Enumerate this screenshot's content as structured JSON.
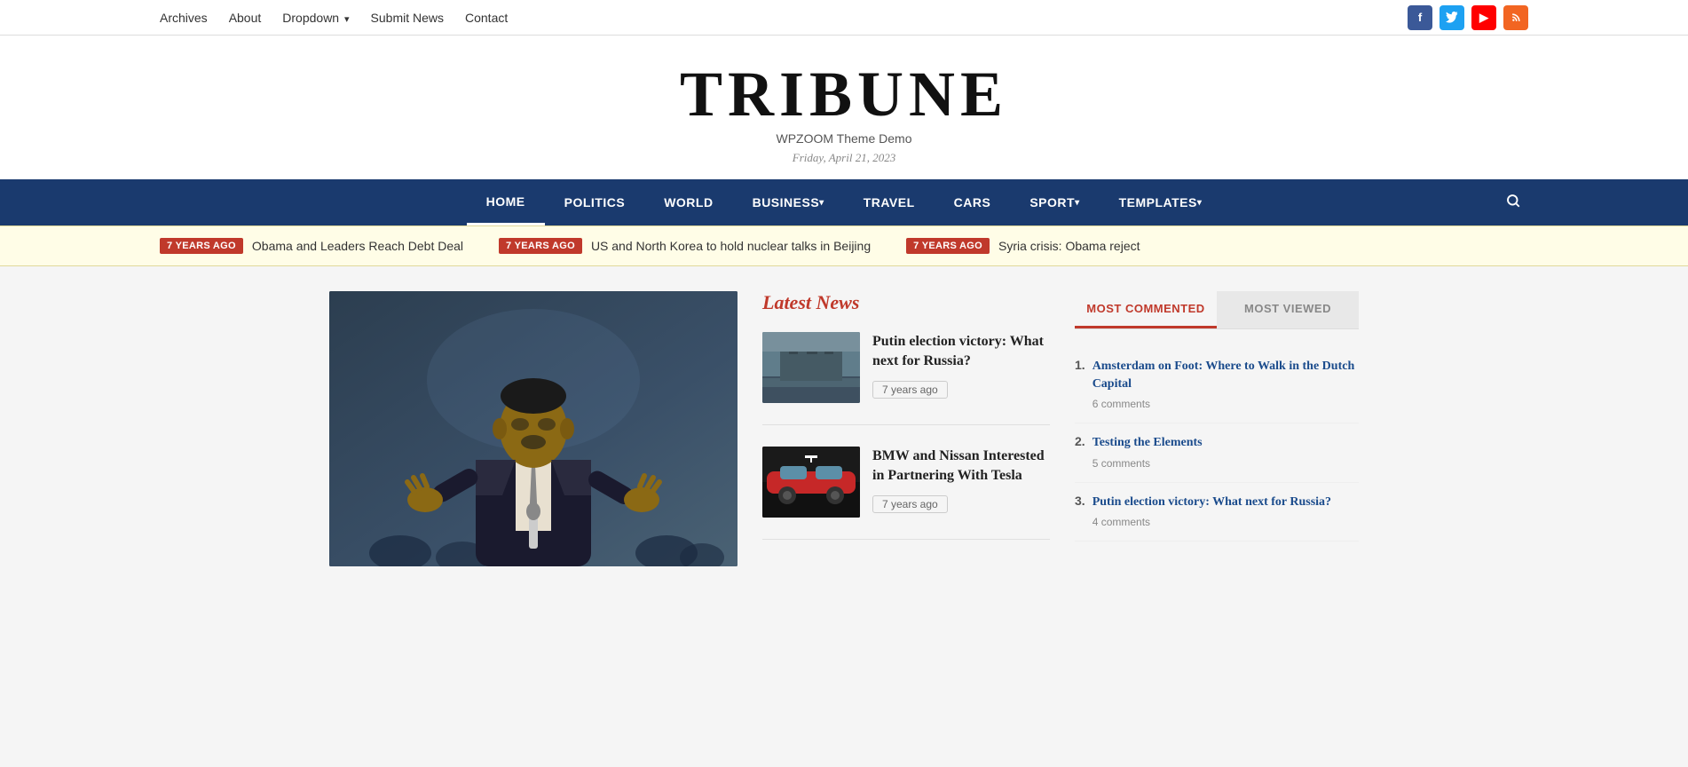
{
  "topnav": {
    "links": [
      {
        "label": "Archives",
        "href": "#",
        "hasDropdown": false
      },
      {
        "label": "About",
        "href": "#",
        "hasDropdown": false
      },
      {
        "label": "Dropdown",
        "href": "#",
        "hasDropdown": true
      },
      {
        "label": "Submit News",
        "href": "#",
        "hasDropdown": false
      },
      {
        "label": "Contact",
        "href": "#",
        "hasDropdown": false
      }
    ],
    "social": [
      {
        "name": "facebook",
        "symbol": "f"
      },
      {
        "name": "twitter",
        "symbol": "t"
      },
      {
        "name": "youtube",
        "symbol": "▶"
      },
      {
        "name": "rss",
        "symbol": "⌁"
      }
    ]
  },
  "header": {
    "title": "TRIBUNE",
    "subtitle": "WPZOOM Theme Demo",
    "date": "Friday, April 21, 2023"
  },
  "mainnav": {
    "links": [
      {
        "label": "HOME",
        "active": true,
        "hasDropdown": false
      },
      {
        "label": "POLITICS",
        "active": false,
        "hasDropdown": false
      },
      {
        "label": "WORLD",
        "active": false,
        "hasDropdown": false
      },
      {
        "label": "BUSINESS",
        "active": false,
        "hasDropdown": true
      },
      {
        "label": "TRAVEL",
        "active": false,
        "hasDropdown": false
      },
      {
        "label": "CARS",
        "active": false,
        "hasDropdown": false
      },
      {
        "label": "SPORT",
        "active": false,
        "hasDropdown": true
      },
      {
        "label": "TEMPLATES",
        "active": false,
        "hasDropdown": true
      }
    ]
  },
  "ticker": {
    "items": [
      {
        "age": "7 YEARS AGO",
        "text": "Obama and Leaders Reach Debt Deal"
      },
      {
        "age": "7 YEARS AGO",
        "text": "US and North Korea to hold nuclear talks in Beijing"
      },
      {
        "age": "7 YEARS AGO",
        "text": "Syria crisis: Obama reject"
      }
    ]
  },
  "latestnews": {
    "title": "Latest News",
    "items": [
      {
        "headline": "Putin election victory: What next for Russia?",
        "age": "7 years ago",
        "thumb_type": "kremlin"
      },
      {
        "headline": "BMW and Nissan Interested in Partnering With Tesla",
        "age": "7 years ago",
        "thumb_type": "tesla"
      }
    ]
  },
  "sidebar": {
    "tabs": [
      {
        "label": "MOST COMMENTED",
        "active": true
      },
      {
        "label": "MOST VIEWED",
        "active": false
      }
    ],
    "mostCommented": [
      {
        "num": "1.",
        "link": "Amsterdam on Foot: Where to Walk in the Dutch Capital",
        "comments": "6 comments"
      },
      {
        "num": "2.",
        "link": "Testing the Elements",
        "comments": "5 comments"
      },
      {
        "num": "3.",
        "link": "Putin election victory: What next for Russia?",
        "comments": "4 comments"
      }
    ]
  }
}
